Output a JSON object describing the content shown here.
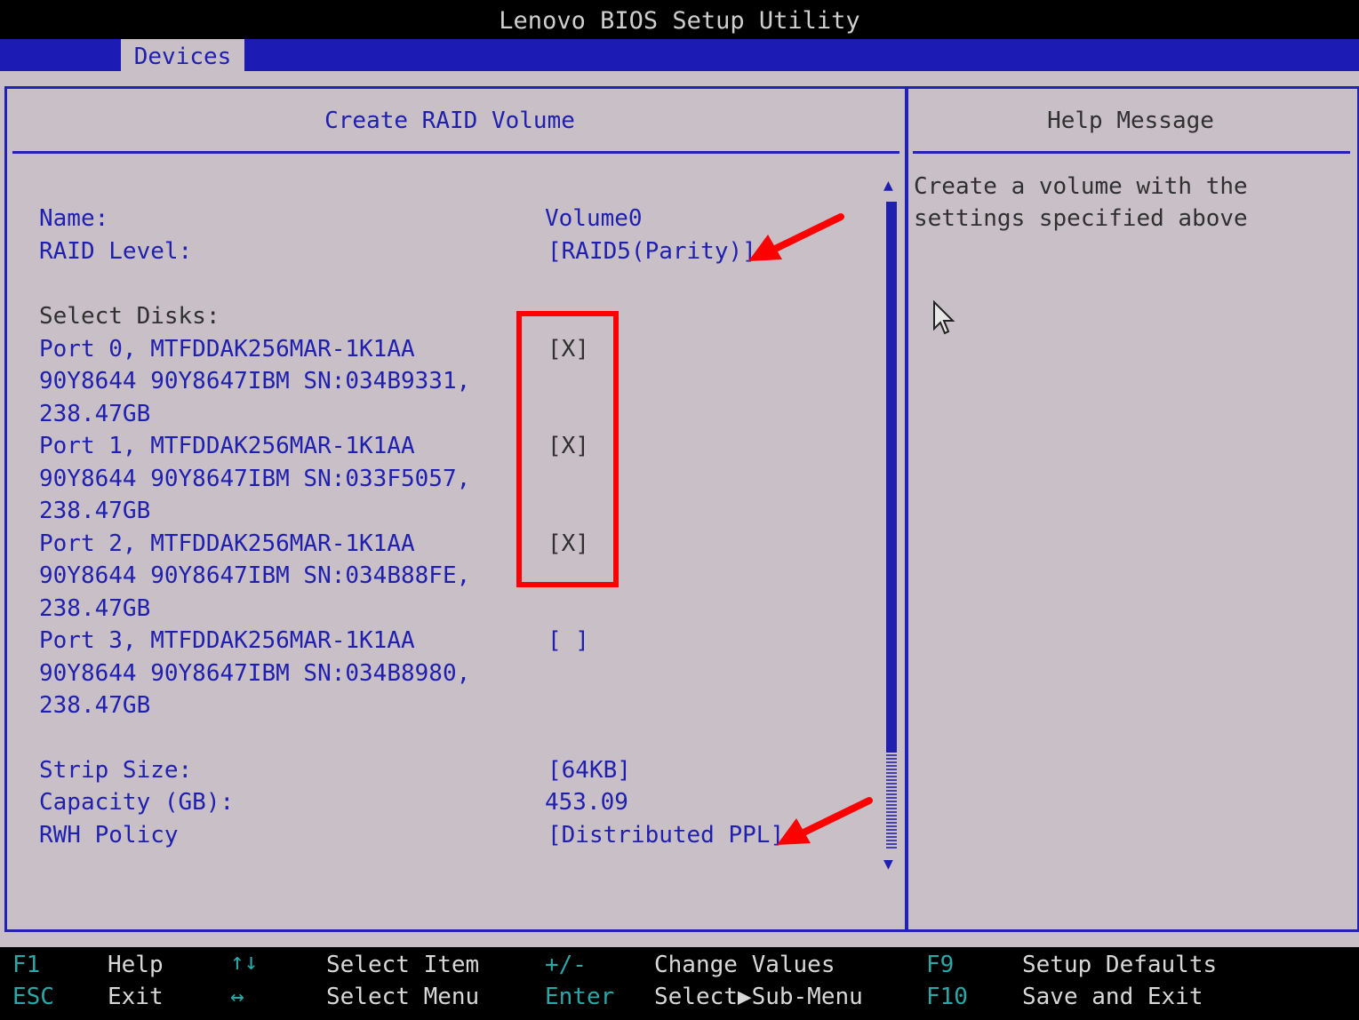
{
  "window": {
    "title": "Lenovo BIOS Setup Utility"
  },
  "menubar": {
    "active_tab": "Devices"
  },
  "main": {
    "heading": "Create RAID Volume",
    "name_label": "Name:",
    "name_value": "Volume0",
    "raid_level_label": "RAID Level:",
    "raid_level_value": "[RAID5(Parity)]",
    "select_disks_label": "Select Disks:",
    "disks": [
      {
        "line1": "Port 0, MTFDDAK256MAR-1K1AA",
        "line2": "90Y8644 90Y8647IBM SN:034B9331,",
        "line3": "238.47GB",
        "checkbox": "[X]"
      },
      {
        "line1": "Port 1, MTFDDAK256MAR-1K1AA",
        "line2": "90Y8644 90Y8647IBM SN:033F5057,",
        "line3": "238.47GB",
        "checkbox": "[X]"
      },
      {
        "line1": "Port 2, MTFDDAK256MAR-1K1AA",
        "line2": "90Y8644 90Y8647IBM SN:034B88FE,",
        "line3": "238.47GB",
        "checkbox": "[X]"
      },
      {
        "line1": "Port 3, MTFDDAK256MAR-1K1AA",
        "line2": "90Y8644 90Y8647IBM SN:034B8980,",
        "line3": "238.47GB",
        "checkbox": "[ ]"
      }
    ],
    "strip_size_label": "Strip Size:",
    "strip_size_value": "[64KB]",
    "capacity_label": "Capacity (GB):",
    "capacity_value": "453.09",
    "rwh_policy_label": "RWH Policy",
    "rwh_policy_value": "[Distributed PPL]"
  },
  "help": {
    "heading": "Help Message",
    "line1": "Create a volume with the",
    "line2": "settings specified above"
  },
  "footer": {
    "rows": [
      [
        {
          "key": "F1",
          "desc": "Help"
        },
        {
          "key": "↑↓",
          "desc": "Select Item"
        },
        {
          "key": "+/-",
          "desc": "Change Values"
        },
        {
          "key": "F9",
          "desc": "Setup Defaults"
        }
      ],
      [
        {
          "key": "ESC",
          "desc": "Exit"
        },
        {
          "key": "↔",
          "desc": "Select Menu"
        },
        {
          "key": "Enter",
          "desc": "Select▶Sub-Menu"
        },
        {
          "key": "F10",
          "desc": "Save and Exit"
        }
      ]
    ]
  },
  "colors": {
    "background": "#c9bfc6",
    "accent": "#2020b0",
    "annotation": "#ff0000"
  },
  "icons": [
    "mouse-cursor-icon",
    "scroll-up-arrow-icon",
    "scroll-down-arrow-icon",
    "annotation-arrow-icon"
  ]
}
